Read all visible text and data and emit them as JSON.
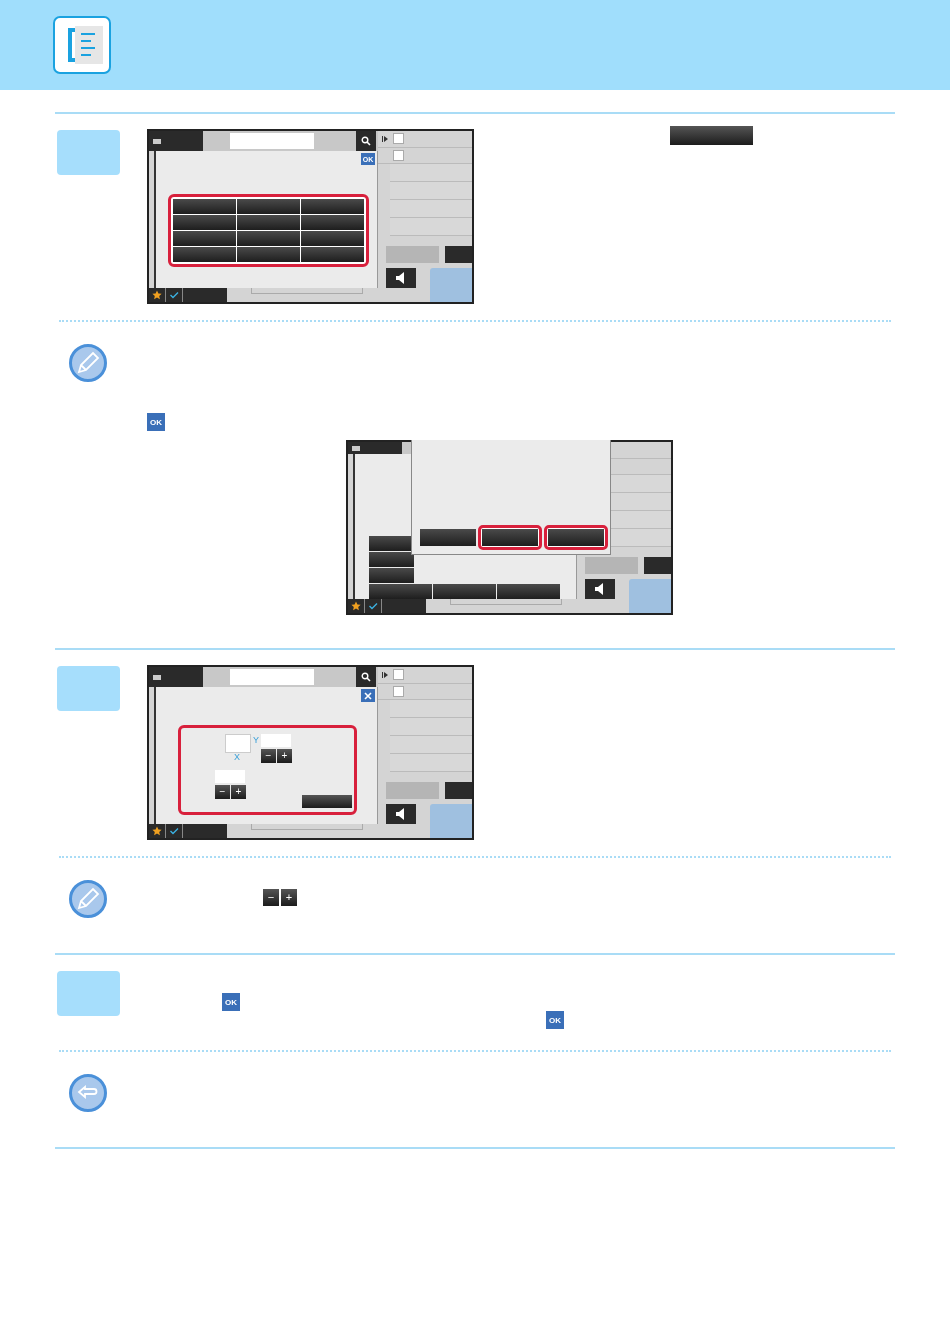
{
  "header": {
    "kind": "fax"
  },
  "sections": [
    {
      "kind": "step",
      "inline": {
        "kind": "dark-key"
      },
      "screen": {
        "kind": "key-grid",
        "ok": "OK",
        "checkboxes": [
          {
            "checked": false
          },
          {
            "checked": false
          }
        ]
      }
    },
    {
      "kind": "hint",
      "inline": {
        "kind": "ok",
        "label": "OK"
      },
      "screen": {
        "kind": "popup"
      }
    },
    {
      "kind": "step",
      "screen": {
        "kind": "size",
        "axis_y": "Y",
        "axis_x": "X",
        "minus": "−",
        "plus": "+",
        "checkboxes": [
          {
            "checked": false
          },
          {
            "checked": false
          }
        ]
      }
    },
    {
      "kind": "hint",
      "inline": {
        "kind": "minus-plus",
        "minus": "−",
        "plus": "+"
      }
    },
    {
      "kind": "step",
      "inline": {
        "kind": "two-ok",
        "label": "OK",
        "label_2": "OK"
      }
    },
    {
      "kind": "return"
    }
  ]
}
